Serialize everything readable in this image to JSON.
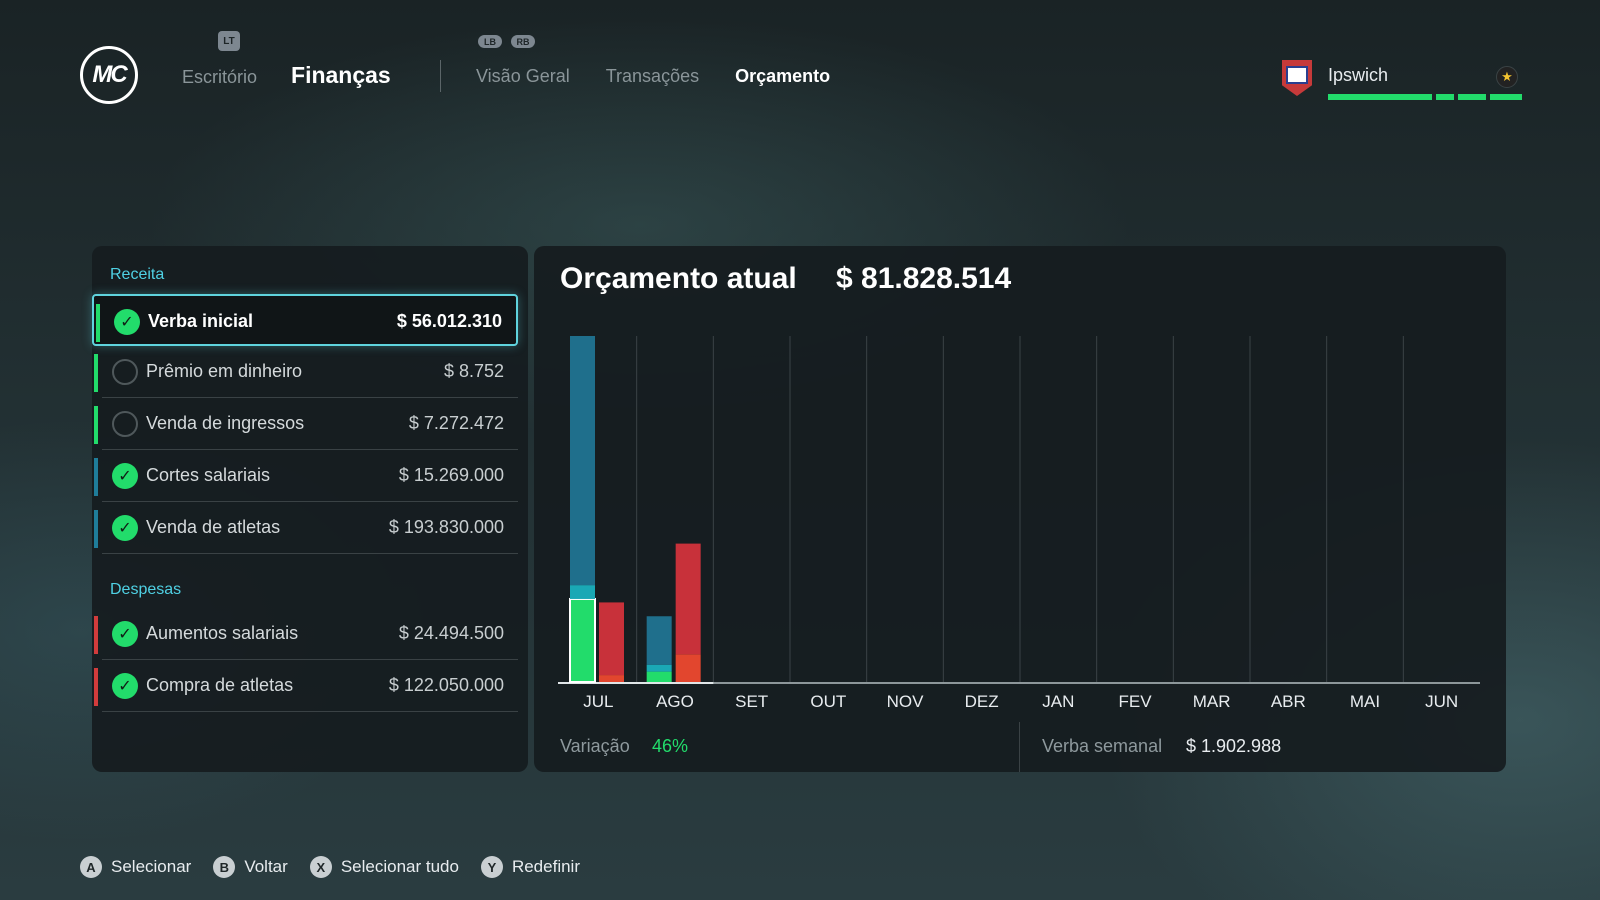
{
  "app": {
    "logo_text": "MC"
  },
  "top_nav": {
    "lt_badge": "LT",
    "lb_badge": "LB",
    "rb_badge": "RB",
    "items": [
      {
        "label": "Escritório"
      },
      {
        "label": "Finanças"
      }
    ],
    "subtabs": [
      {
        "label": "Visão Geral"
      },
      {
        "label": "Transações"
      },
      {
        "label": "Orçamento"
      }
    ]
  },
  "club": {
    "name": "Ipswich",
    "star": "★"
  },
  "left_panel": {
    "revenue_header": "Receita",
    "expenses_header": "Despesas",
    "revenue_items": [
      {
        "label": "Verba inicial",
        "value": "$ 56.012.310",
        "checked": true,
        "color": "#22dc6b"
      },
      {
        "label": "Prêmio em dinheiro",
        "value": "$ 8.752",
        "checked": false,
        "color": "#22dc6b"
      },
      {
        "label": "Venda de ingressos",
        "value": "$ 7.272.472",
        "checked": false,
        "color": "#22dc6b"
      },
      {
        "label": "Cortes salariais",
        "value": "$ 15.269.000",
        "checked": true,
        "color": "#1f7d9a"
      },
      {
        "label": "Venda de atletas",
        "value": "$ 193.830.000",
        "checked": true,
        "color": "#1f7d9a"
      }
    ],
    "expense_items": [
      {
        "label": "Aumentos salariais",
        "value": "$ 24.494.500",
        "checked": true,
        "color": "#d23c3c"
      },
      {
        "label": "Compra de atletas",
        "value": "$ 122.050.000",
        "checked": true,
        "color": "#d23c3c"
      }
    ]
  },
  "chart_panel": {
    "title": "Orçamento atual",
    "total": "$ 81.828.514",
    "variation_label": "Variação",
    "variation_value": "46%",
    "weekly_label": "Verba semanal",
    "weekly_value": "$ 1.902.988"
  },
  "chart_data": {
    "type": "bar",
    "categories": [
      "JUL",
      "AGO",
      "SET",
      "OUT",
      "NOV",
      "DEZ",
      "JAN",
      "FEV",
      "MAR",
      "ABR",
      "MAI",
      "JUN"
    ],
    "stacked": true,
    "revenue_stack": [
      {
        "name": "",
        "color": "#22dc6b",
        "values": [
          24,
          3,
          0,
          0,
          0,
          0,
          0,
          0,
          0,
          0,
          0,
          0
        ]
      },
      {
        "name": "",
        "color": "#1aa8b5",
        "values": [
          4,
          2,
          0,
          0,
          0,
          0,
          0,
          0,
          0,
          0,
          0,
          0
        ]
      },
      {
        "name": "",
        "color": "#1f6f8c",
        "values": [
          72,
          14,
          0,
          0,
          0,
          0,
          0,
          0,
          0,
          0,
          0,
          0
        ]
      }
    ],
    "expense_stack": [
      {
        "name": "",
        "color": "#e2462e",
        "values": [
          2,
          8,
          0,
          0,
          0,
          0,
          0,
          0,
          0,
          0,
          0,
          0
        ]
      },
      {
        "name": "",
        "color": "#c8313a",
        "values": [
          21,
          32,
          0,
          0,
          0,
          0,
          0,
          0,
          0,
          0,
          0,
          0
        ]
      }
    ],
    "ylim": [
      0,
      100
    ],
    "grid": true,
    "legend": "none"
  },
  "hints": [
    {
      "button": "A",
      "label": "Selecionar"
    },
    {
      "button": "B",
      "label": "Voltar"
    },
    {
      "button": "X",
      "label": "Selecionar tudo"
    },
    {
      "button": "Y",
      "label": "Redefinir"
    }
  ]
}
